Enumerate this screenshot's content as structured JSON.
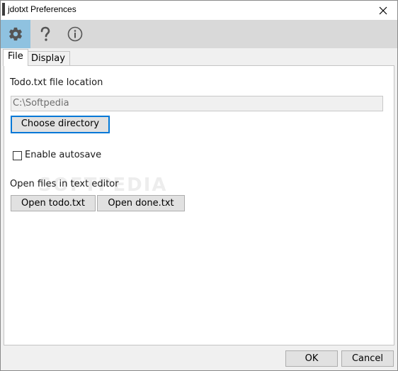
{
  "window": {
    "title": "jdotxt Preferences"
  },
  "toolbar": {
    "items": [
      {
        "icon": "gear-icon"
      },
      {
        "icon": "question-icon"
      },
      {
        "icon": "info-icon"
      }
    ],
    "active_index": 0
  },
  "tabs": [
    {
      "label": "File",
      "selected": true
    },
    {
      "label": "Display",
      "selected": false
    }
  ],
  "file_tab": {
    "location_label": "Todo.txt file location",
    "location_value": "C:\\Softpedia",
    "choose_button": "Choose directory",
    "autosave_label": "Enable autosave",
    "autosave_checked": false,
    "editor_label": "Open files in text editor",
    "open_todo_button": "Open todo.txt",
    "open_done_button": "Open done.txt",
    "watermark": "SOFTPEDIA"
  },
  "footer": {
    "ok_label": "OK",
    "cancel_label": "Cancel"
  },
  "colors": {
    "toolbar_bg": "#d9d9d9",
    "toolbar_active": "#8fc2e0",
    "focus_border": "#0078d7",
    "icon_color": "#555555"
  }
}
